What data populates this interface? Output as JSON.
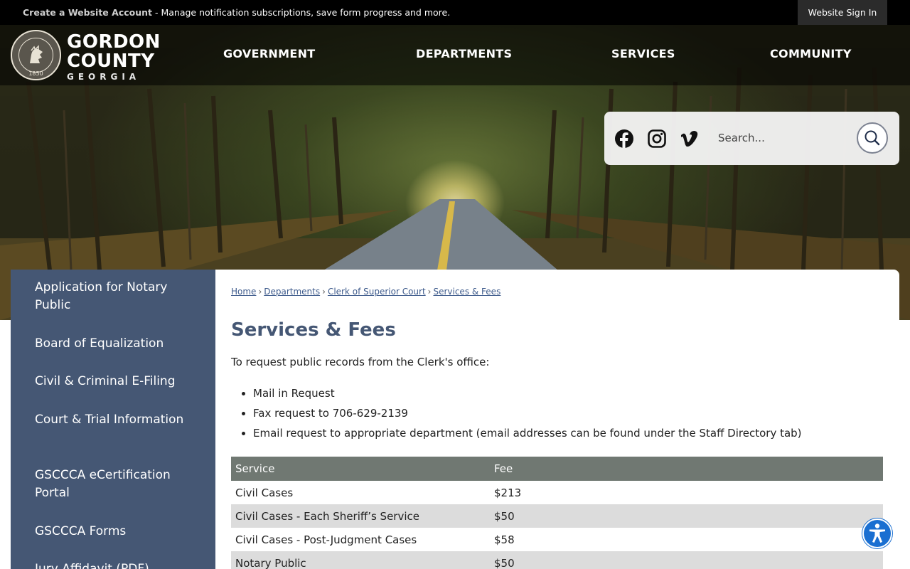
{
  "topbar": {
    "create_account": "Create a Website Account",
    "message": " - Manage notification subscriptions, save form progress and more.",
    "sign_in": "Website Sign In"
  },
  "logo": {
    "line1": "GORDON",
    "line2": "COUNTY",
    "line3": "GEORGIA",
    "seal_year": "1850"
  },
  "nav": {
    "items": [
      "GOVERNMENT",
      "DEPARTMENTS",
      "SERVICES",
      "COMMUNITY"
    ]
  },
  "search": {
    "placeholder": "Search...",
    "social": [
      "facebook-icon",
      "instagram-icon",
      "vimeo-icon"
    ]
  },
  "sidebar": {
    "items": [
      "Application for Notary Public",
      "Board of Equalization",
      "Civil & Criminal E-Filing",
      "Court & Trial Information",
      "GSCCCA eCertification Portal",
      "GSCCCA Forms",
      "Jury Affidavit (PDF)"
    ]
  },
  "breadcrumb": [
    "Home",
    "Departments",
    "Clerk of Superior Court",
    "Services & Fees"
  ],
  "page": {
    "title": "Services & Fees",
    "intro": "To request public records from the Clerk's office:",
    "bullets": [
      "Mail in Request",
      "Fax request to 706-629-2139",
      "Email request to appropriate department (email addresses can be found under the Staff Directory tab)"
    ]
  },
  "fees_table": {
    "headers": [
      "Service",
      "Fee"
    ],
    "rows": [
      [
        "Civil Cases",
        "$213"
      ],
      [
        "Civil Cases - Each Sheriff’s Service",
        "$50"
      ],
      [
        "Civil Cases - Post-Judgment Cases",
        "$58"
      ],
      [
        "Notary Public",
        "$50"
      ]
    ]
  },
  "colors": {
    "sidebar_bg": "#455774",
    "title_color": "#455774",
    "table_header_bg": "#707872",
    "accessibility_blue": "#1a6fd1"
  }
}
